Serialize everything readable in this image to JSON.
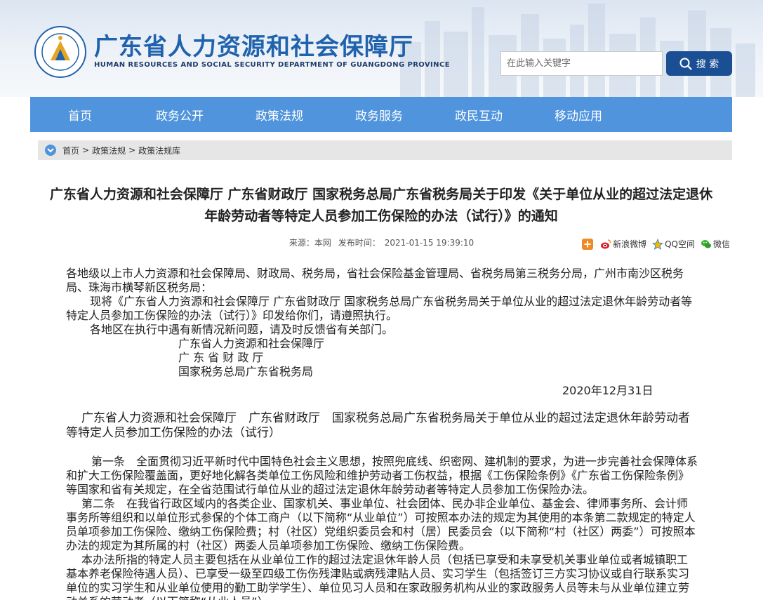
{
  "header": {
    "title": "广东省人力资源和社会保障厅",
    "subtitle": "HUMAN RESOURCES AND SOCIAL SECURITY DEPARTMENT OF GUANGDONG PROVINCE",
    "emblem_text": "广东省人力资源和社会保障厅",
    "search_placeholder": "在此输入关键字",
    "search_label": "搜 索"
  },
  "nav": {
    "items": [
      {
        "label": "首页"
      },
      {
        "label": "政务公开"
      },
      {
        "label": "政策法规"
      },
      {
        "label": "政务服务"
      },
      {
        "label": "政民互动"
      },
      {
        "label": "移动应用"
      }
    ]
  },
  "breadcrumb": {
    "items": [
      "首页",
      "政策法规",
      "政策法规库"
    ],
    "separator": ">"
  },
  "article": {
    "title_line1": "广东省人力资源和社会保障厅 广东省财政厅 国家税务总局广东省税务局关于印发《关于单位从业的超过法定退休",
    "title_line2": "年龄劳动者等特定人员参加工伤保险的办法（试行）》的通知",
    "source": "来源：本网",
    "publish_time_label": "发布时间：",
    "publish_time": "2021-01-15 19:39:10",
    "share": [
      {
        "label": "",
        "icon": "plus-icon"
      },
      {
        "label": "新浪微博",
        "icon": "weibo-icon"
      },
      {
        "label": "QQ空间",
        "icon": "qzone-icon"
      },
      {
        "label": "微信",
        "icon": "wechat-icon"
      }
    ],
    "salutation": "各地级以上市人力资源和社会保障局、财政局、税务局，省社会保险基金管理局、省税务局第三税务分局，广州市南沙区税务局、珠海市横琴新区税务局：",
    "para1": "现将《广东省人力资源和社会保障厅 广东省财政厅 国家税务总局广东省税务局关于单位从业的超过法定退休年龄劳动者等特定人员参加工伤保险的办法（试行）》印发给你们，请遵照执行。",
    "para2": "各地区在执行中遇有新情况新问题，请及时反馈省有关部门。",
    "sign1": "广东省人力资源和社会保障厅",
    "sign2": "广 东 省 财 政 厅",
    "sign3": "国家税务总局广东省税务局",
    "date": "2020年12月31日",
    "sub_title": "广东省人力资源和社会保障厅　广东省财政厅　国家税务总局广东省税务局关于单位从业的超过法定退休年龄劳动者等特定人员参加工伤保险的办法（试行）",
    "art1": "第一条　全面贯彻习近平新时代中国特色社会主义思想，按照兜底线、织密网、建机制的要求，为进一步完善社会保障体系和扩大工伤保险覆盖面，更好地化解各类单位工伤风险和维护劳动者工伤权益，根据《工伤保险条例》《广东省工伤保险条例》等国家和省有关规定，在全省范围试行单位从业的超过法定退休年龄劳动者等特定人员参加工伤保险办法。",
    "art2": "第二条　在我省行政区域内的各类企业、国家机关、事业单位、社会团体、民办非企业单位、基金会、律师事务所、会计师事务所等组织和以单位形式参保的个体工商户（以下简称“从业单位”）可按照本办法的规定为其使用的本条第二款规定的特定人员单项参加工伤保险、缴纳工伤保险费；村（社区）党组织委员会和村（居）民委员会（以下简称“村（社区）两委”）可按照本办法的规定为其所属的村（社区）两委人员单项参加工伤保险、缴纳工伤保险费。",
    "art3": "本办法所指的特定人员主要包括在从业单位工作的超过法定退休年龄人员（包括已享受和未享受机关事业单位或者城镇职工基本养老保险待遇人员）、已享受一级至四级工伤伤残津贴或病残津贴人员、实习学生（包括签订三方实习协议或自行联系实习单位的实习学生和从业单位使用的勤工助学学生）、单位见习人员和在家政服务机构从业的家政服务人员等未与从业单位建立劳动关系的劳动者（以下简称“从业人员”）。"
  },
  "colors": {
    "brand_blue": "#1f62ad",
    "nav_bg": "#4f94dc",
    "search_btn": "#1b4f94",
    "breadcrumb_bg": "#e6e6e6"
  }
}
